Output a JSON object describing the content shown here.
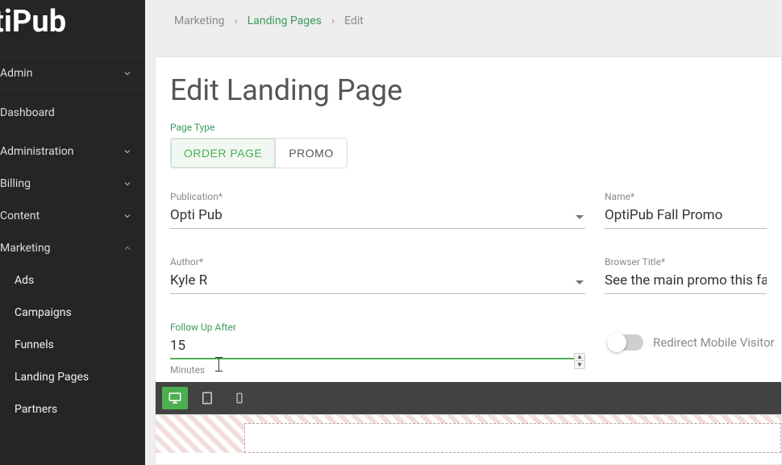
{
  "brand": "tiPub",
  "sidebar": {
    "admin": "Admin",
    "dashboard": "Dashboard",
    "administration": "Administration",
    "billing": "Billing",
    "content": "Content",
    "marketing": "Marketing",
    "marketing_items": {
      "ads": "Ads",
      "campaigns": "Campaigns",
      "funnels": "Funnels",
      "landing_pages": "Landing Pages",
      "partners": "Partners"
    }
  },
  "crumbs": {
    "marketing": "Marketing",
    "landing_pages": "Landing Pages",
    "edit": "Edit"
  },
  "page": {
    "title": "Edit Landing Page",
    "page_type_label": "Page Type",
    "order_page": "ORDER PAGE",
    "promo": "PROMO"
  },
  "fields": {
    "publication_label": "Publication*",
    "publication_value": "Opti Pub",
    "name_label": "Name*",
    "name_value": "OptiPub Fall Promo",
    "author_label": "Author*",
    "author_value": "Kyle R",
    "browser_title_label": "Browser Title*",
    "browser_title_value": "See the main promo this fall.",
    "followup_label": "Follow Up After",
    "followup_value": "15",
    "followup_helper": "Minutes",
    "redirect_label": "Redirect Mobile Visitor"
  }
}
